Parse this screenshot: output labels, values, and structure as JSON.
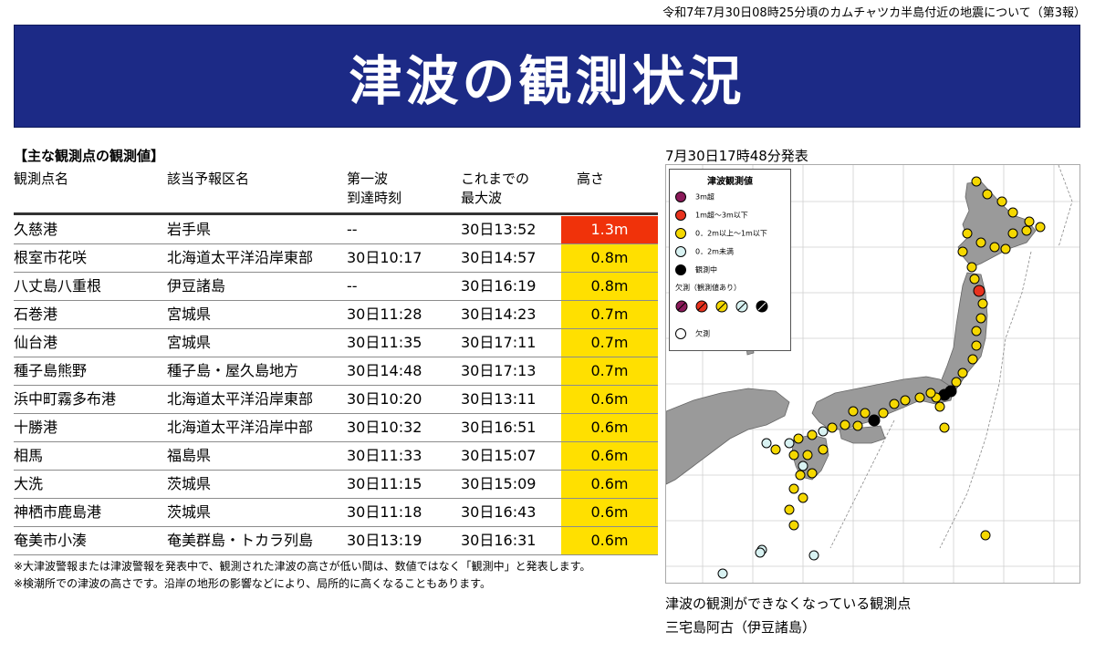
{
  "header_note": "令和7年7月30日08時25分頃のカムチャツカ半島付近の地震について（第3報）",
  "title": "津波の観測状況",
  "section_label": "【主な観測点の観測値】",
  "table": {
    "columns": [
      "観測点名",
      "該当予報区名",
      "第一波\n到達時刻",
      "これまでの\n最大波",
      "高さ"
    ],
    "rows": [
      {
        "name": "久慈港",
        "area": "岩手県",
        "first": "--",
        "max": "30日13:52",
        "height": "1.3m",
        "level": "high"
      },
      {
        "name": "根室市花咲",
        "area": "北海道太平洋沿岸東部",
        "first": "30日10:17",
        "max": "30日14:57",
        "height": "0.8m",
        "level": "mid"
      },
      {
        "name": "八丈島八重根",
        "area": "伊豆諸島",
        "first": "--",
        "max": "30日16:19",
        "height": "0.8m",
        "level": "mid"
      },
      {
        "name": "石巻港",
        "area": "宮城県",
        "first": "30日11:28",
        "max": "30日14:23",
        "height": "0.7m",
        "level": "mid"
      },
      {
        "name": "仙台港",
        "area": "宮城県",
        "first": "30日11:35",
        "max": "30日17:11",
        "height": "0.7m",
        "level": "mid"
      },
      {
        "name": "種子島熊野",
        "area": "種子島・屋久島地方",
        "first": "30日14:48",
        "max": "30日17:13",
        "height": "0.7m",
        "level": "mid"
      },
      {
        "name": "浜中町霧多布港",
        "area": "北海道太平洋沿岸東部",
        "first": "30日10:20",
        "max": "30日13:11",
        "height": "0.6m",
        "level": "mid"
      },
      {
        "name": "十勝港",
        "area": "北海道太平洋沿岸中部",
        "first": "30日10:32",
        "max": "30日16:51",
        "height": "0.6m",
        "level": "mid"
      },
      {
        "name": "相馬",
        "area": "福島県",
        "first": "30日11:33",
        "max": "30日15:07",
        "height": "0.6m",
        "level": "mid"
      },
      {
        "name": "大洗",
        "area": "茨城県",
        "first": "30日11:15",
        "max": "30日15:09",
        "height": "0.6m",
        "level": "mid"
      },
      {
        "name": "神栖市鹿島港",
        "area": "茨城県",
        "first": "30日11:18",
        "max": "30日16:43",
        "height": "0.6m",
        "level": "mid"
      },
      {
        "name": "奄美市小湊",
        "area": "奄美群島・トカラ列島",
        "first": "30日13:19",
        "max": "30日16:31",
        "height": "0.6m",
        "level": "mid"
      }
    ]
  },
  "footnotes": [
    "※大津波警報または津波警報を発表中で、観測された津波の高さが低い間は、数値ではなく「観測中」と発表します。",
    "※検潮所での津波の高さです。沿岸の地形の影響などにより、局所的に高くなることもあります。"
  ],
  "map": {
    "issued": "7月30日17時48分発表",
    "legend_title": "津波観測値",
    "legend_items": [
      {
        "label": "3m超",
        "color": "#8b1a5a"
      },
      {
        "label": "1m超～3m以下",
        "color": "#e8321e"
      },
      {
        "label": "0．2m以上～1m以下",
        "color": "#f5d800"
      },
      {
        "label": "0．2m未満",
        "color": "#d8f2f2"
      },
      {
        "label": "観測中",
        "color": "#000000"
      }
    ],
    "legend_missing_label": "欠測（観測値あり）",
    "legend_missing_only": "欠測",
    "caption_lines": [
      "津波の観測ができなくなっている観測点",
      "三宅島阿古（伊豆諸島）"
    ]
  },
  "colors": {
    "banner": "#1c2a86",
    "high": "#f0320a",
    "mid": "#ffe000"
  }
}
